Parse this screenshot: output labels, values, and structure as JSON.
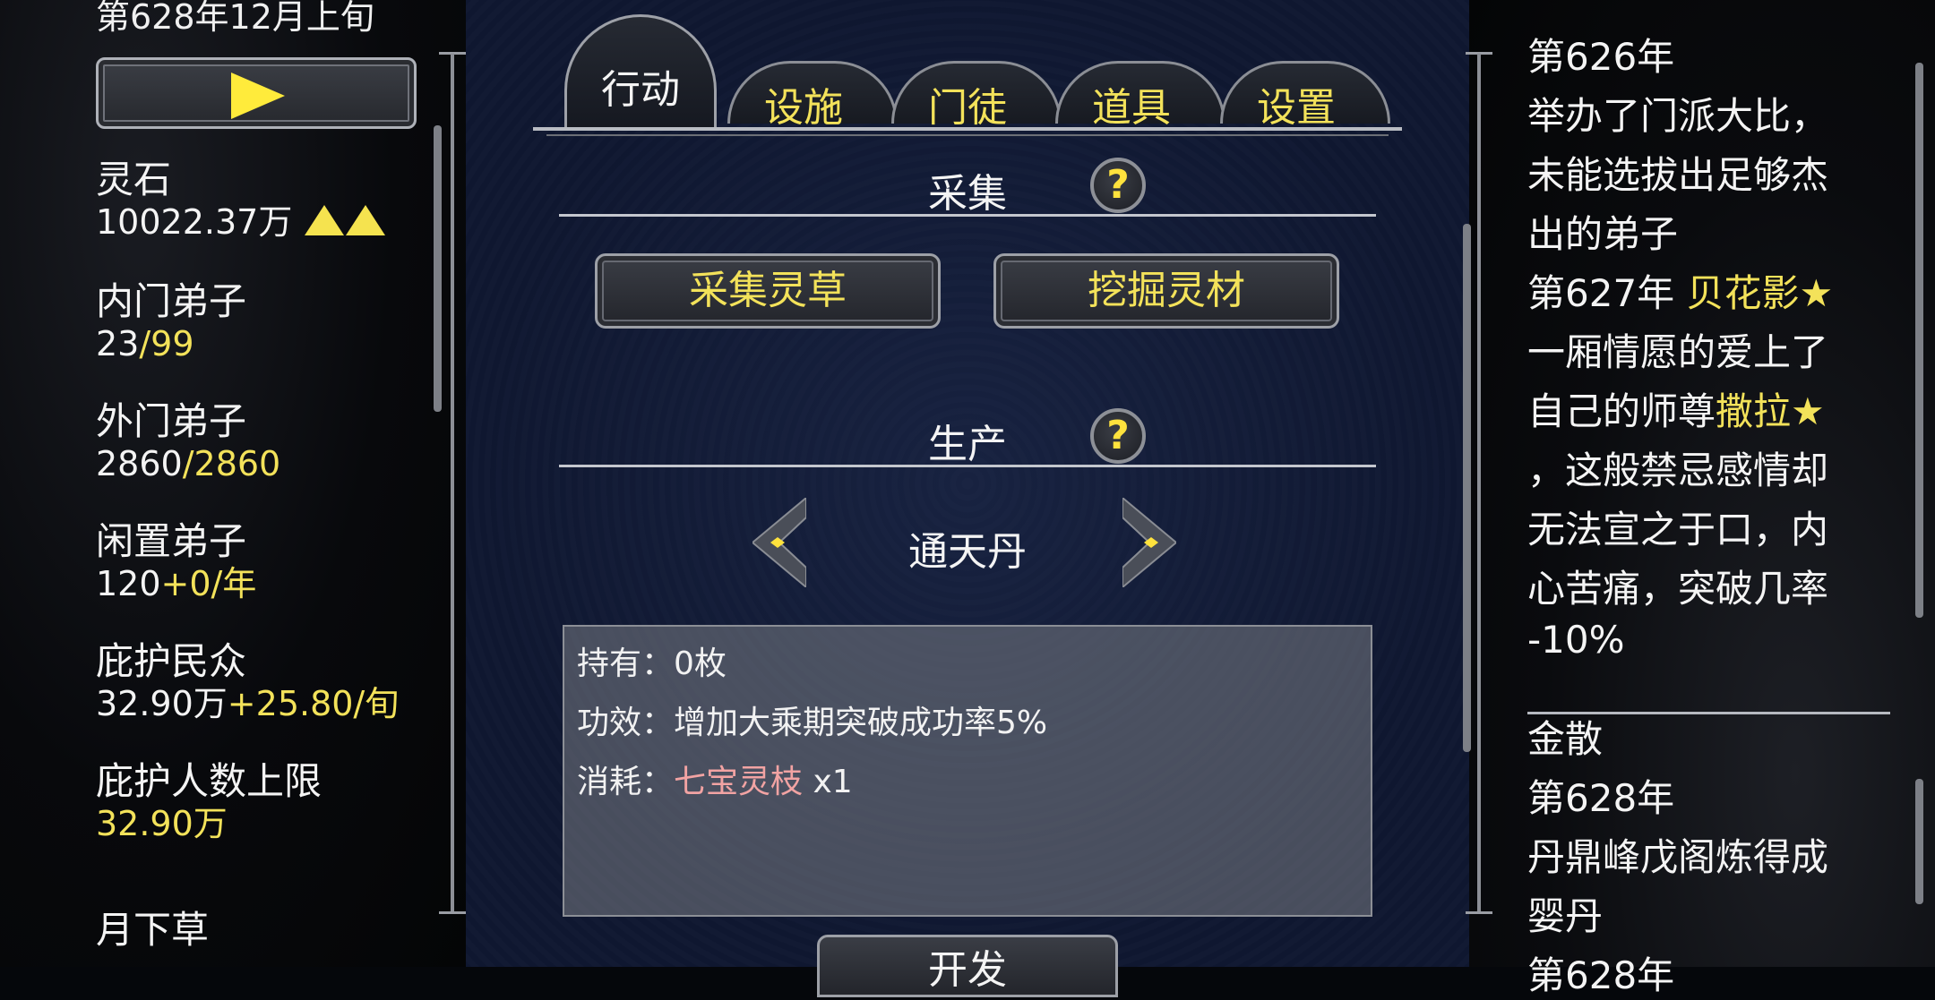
{
  "date_current": "第628年12月上旬",
  "play_icon": "play-icon",
  "resources": [
    {
      "label": "灵石",
      "value": "10022.37万",
      "extra": ""
    },
    {
      "label": "内门弟子",
      "value": "23",
      "extra": "/99"
    },
    {
      "label": "外门弟子",
      "value": "2860",
      "extra": "/2860"
    },
    {
      "label": "闲置弟子",
      "value": "120",
      "extra": "+0/年"
    },
    {
      "label": "庇护民众",
      "value": "32.90万",
      "extra": "+25.80/旬"
    },
    {
      "label": "庇护人数上限",
      "value": "",
      "extra": "32.90万"
    },
    {
      "label": "月下草",
      "value": "",
      "extra": ""
    }
  ],
  "tabs": [
    {
      "label": "行动",
      "active": true
    },
    {
      "label": "设施",
      "active": false
    },
    {
      "label": "门徒",
      "active": false
    },
    {
      "label": "道具",
      "active": false
    },
    {
      "label": "设置",
      "active": false
    }
  ],
  "gather": {
    "title": "采集",
    "help": "?",
    "buttons": [
      "采集灵草",
      "挖掘灵材"
    ]
  },
  "produce": {
    "title": "生产",
    "help": "?",
    "item_name": "通天丹",
    "owned_label": "持有：",
    "owned_value": "0枚",
    "effect_label": "功效：",
    "effect_value": "增加大乘期突破成功率5%",
    "cost_label": "消耗：",
    "cost_item": "七宝灵枝",
    "cost_qty": " x1",
    "develop_button": "开发"
  },
  "log": {
    "lines": [
      {
        "text": "第626年",
        "hl": ""
      },
      {
        "text": "举办了门派大比，",
        "hl": ""
      },
      {
        "text": "未能选拔出足够杰",
        "hl": ""
      },
      {
        "text": "出的弟子",
        "hl": ""
      },
      {
        "text": "第627年 ",
        "hl": "贝花影★"
      },
      {
        "text": "一厢情愿的爱上了",
        "hl": ""
      },
      {
        "text": "自己的师尊",
        "hl": "撒拉★"
      },
      {
        "text": "，这般禁忌感情却",
        "hl": ""
      },
      {
        "text": "无法宣之于口，内",
        "hl": ""
      },
      {
        "text": "心苦痛，突破几率",
        "hl": ""
      },
      {
        "text": "-10%",
        "hl": ""
      }
    ],
    "lines2": [
      {
        "text": "金散"
      },
      {
        "text": "第628年"
      },
      {
        "text": "丹鼎峰戊阁炼得成"
      },
      {
        "text": "婴丹"
      },
      {
        "text": "第628年"
      }
    ]
  },
  "colors": {
    "accent_yellow": "#f3e25a",
    "pink": "#f2a3a3",
    "bg_center": "#101831"
  }
}
